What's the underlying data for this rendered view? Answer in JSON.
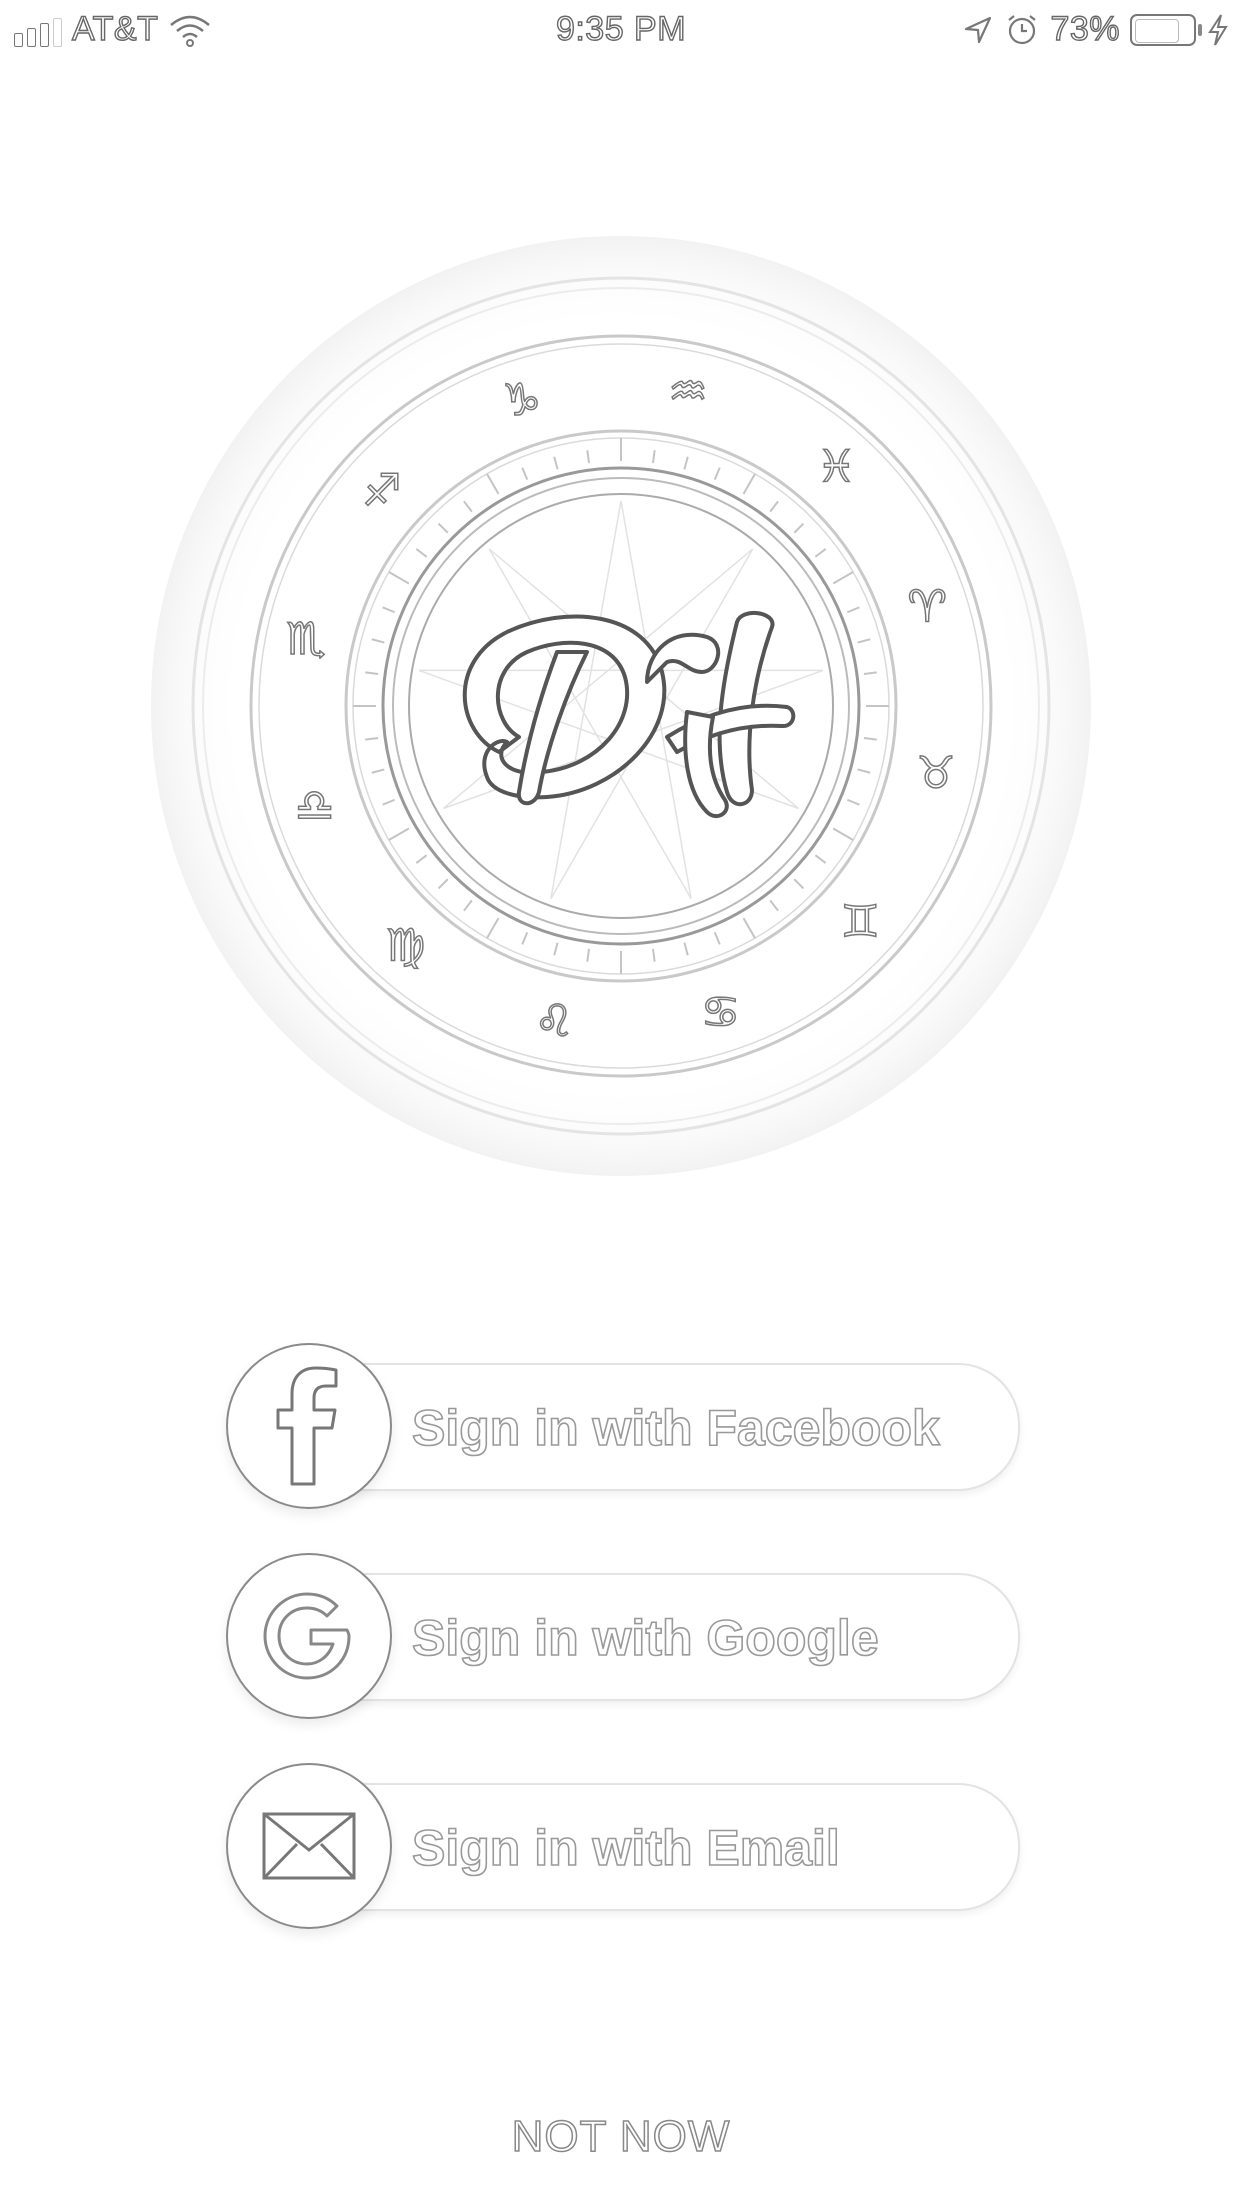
{
  "status_bar": {
    "carrier": "AT&T",
    "time": "9:35 PM",
    "battery_percent": "73%",
    "icons": [
      "signal-bars-icon",
      "wifi-icon",
      "location-arrow-icon",
      "alarm-clock-icon",
      "battery-icon",
      "charging-bolt-icon"
    ]
  },
  "logo": {
    "name": "DH zodiac emblem",
    "zodiac_signs": [
      "♑",
      "♒",
      "♓",
      "♈",
      "♉",
      "♊",
      "♋",
      "♌",
      "♍",
      "♎",
      "♏",
      "♐"
    ]
  },
  "signin": {
    "facebook_label": "Sign in with Facebook",
    "google_label": "Sign in with Google",
    "email_label": "Sign in with Email",
    "facebook_icon": "facebook-f-icon",
    "google_icon": "google-g-icon",
    "email_icon": "envelope-icon"
  },
  "not_now": "NOT NOW",
  "colors": {
    "background": "#ffffff",
    "outline": "#8a8a8a",
    "pill_border": "#e3e3e3"
  }
}
